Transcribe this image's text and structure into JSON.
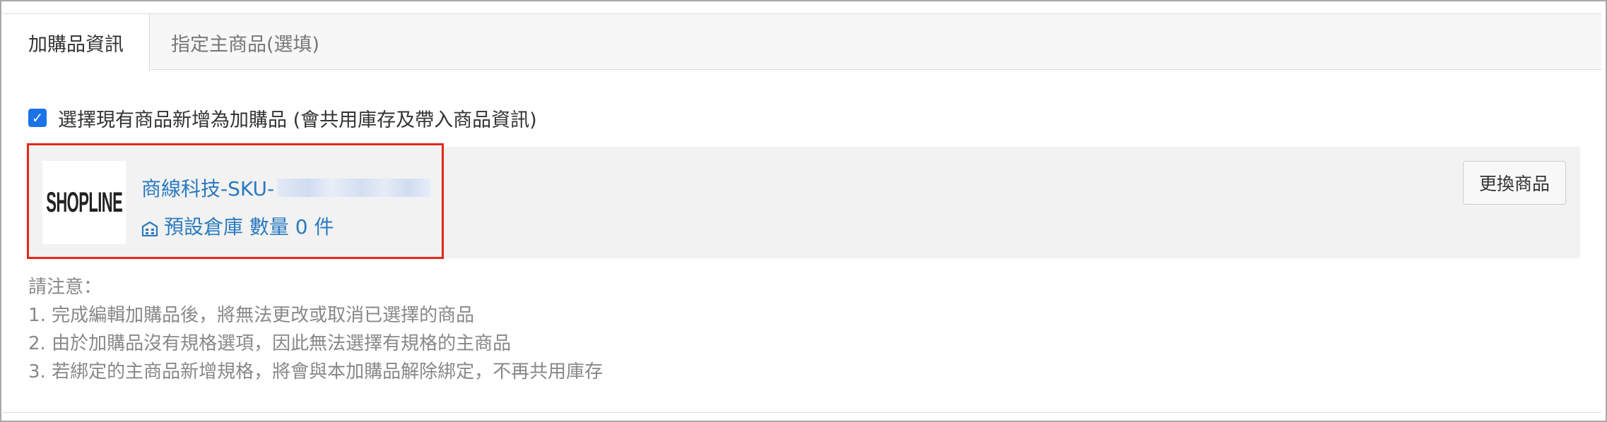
{
  "tabs": [
    {
      "label": "加購品資訊",
      "active": true
    },
    {
      "label": "指定主商品(選填)",
      "active": false
    }
  ],
  "checkbox": {
    "checked": true,
    "label": "選擇現有商品新增為加購品 (會共用庫存及帶入商品資訊)"
  },
  "product": {
    "logo_text": "SHOPLINE",
    "name": "商線科技-SKU-",
    "stock_icon": "warehouse-icon",
    "stock_text": "預設倉庫 數量 0 件",
    "replace_label": "更換商品"
  },
  "notes": {
    "title": "請注意：",
    "items": [
      "1. 完成編輯加購品後，將無法更改或取消已選擇的商品",
      "2. 由於加購品沒有規格選項，因此無法選擇有規格的主商品",
      "3. 若綁定的主商品新增規格，將會與本加購品解除綁定，不再共用庫存"
    ]
  },
  "colors": {
    "accent": "#2a7ac0",
    "checkbox": "#1a73e8",
    "highlight": "#e4271b"
  }
}
